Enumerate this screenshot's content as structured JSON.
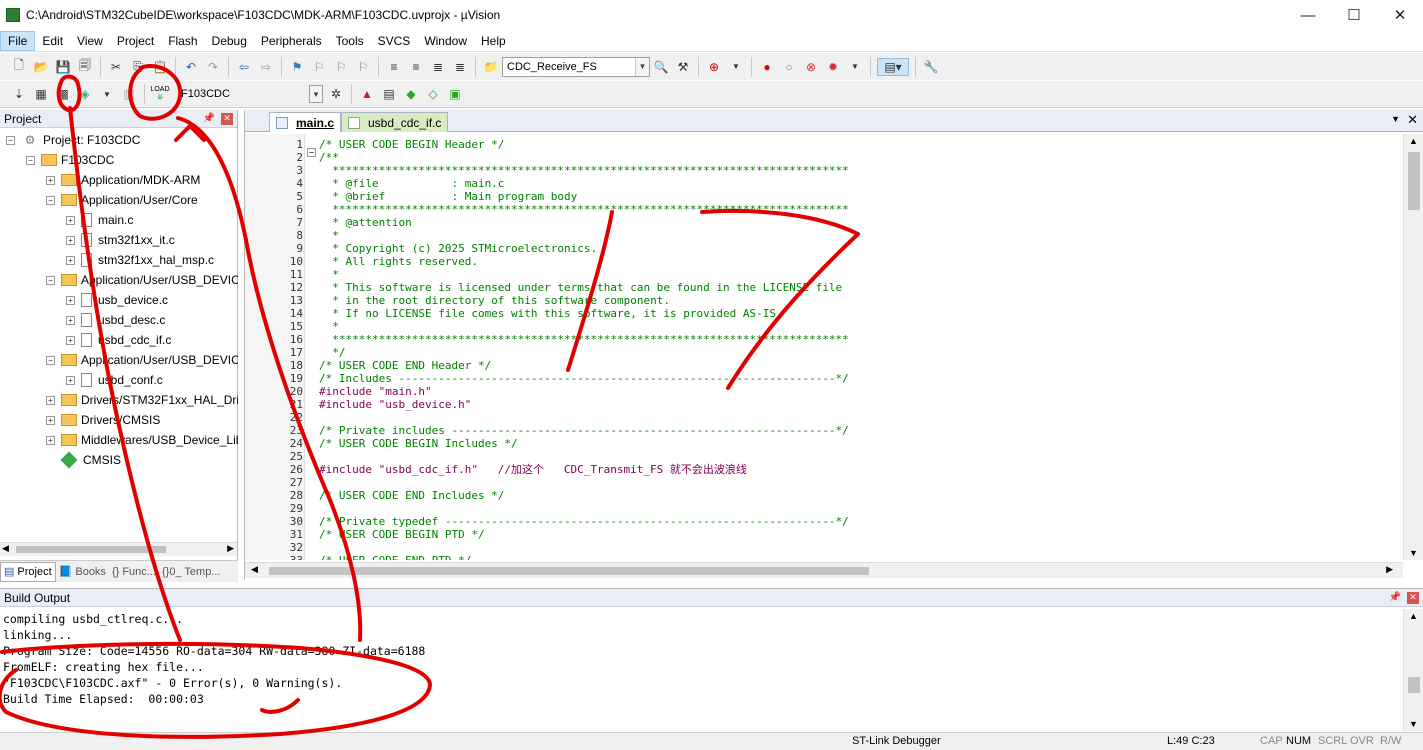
{
  "window": {
    "title": "C:\\Android\\STM32CubeIDE\\workspace\\F103CDC\\MDK-ARM\\F103CDC.uvprojx - µVision",
    "minimize": "—",
    "maximize": "☐",
    "close": "✕"
  },
  "menu": [
    "File",
    "Edit",
    "View",
    "Project",
    "Flash",
    "Debug",
    "Peripherals",
    "Tools",
    "SVCS",
    "Window",
    "Help"
  ],
  "toolbar1": {
    "function_combo": "CDC_Receive_FS"
  },
  "toolbar2": {
    "load_label": "LOAD",
    "target_combo": "F103CDC"
  },
  "project_panel": {
    "title": "Project",
    "tree": [
      {
        "label": "Project: F103CDC",
        "type": "root"
      },
      {
        "label": "F103CDC",
        "type": "target"
      },
      {
        "label": "Application/MDK-ARM",
        "type": "folder"
      },
      {
        "label": "Application/User/Core",
        "type": "folder"
      },
      {
        "label": "main.c",
        "type": "file"
      },
      {
        "label": "stm32f1xx_it.c",
        "type": "file"
      },
      {
        "label": "stm32f1xx_hal_msp.c",
        "type": "file"
      },
      {
        "label": "Application/User/USB_DEVIC",
        "type": "folder"
      },
      {
        "label": "usb_device.c",
        "type": "file"
      },
      {
        "label": "usbd_desc.c",
        "type": "file"
      },
      {
        "label": "usbd_cdc_if.c",
        "type": "file"
      },
      {
        "label": "Application/User/USB_DEVIC",
        "type": "folder"
      },
      {
        "label": "usbd_conf.c",
        "type": "file"
      },
      {
        "label": "Drivers/STM32F1xx_HAL_Driv",
        "type": "folder"
      },
      {
        "label": "Drivers/CMSIS",
        "type": "folder"
      },
      {
        "label": "Middlewares/USB_Device_Lib",
        "type": "folder"
      },
      {
        "label": "CMSIS",
        "type": "component"
      }
    ],
    "tabs": [
      "Project",
      "Books",
      "{} Func...",
      "{}0_ Temp..."
    ]
  },
  "editor": {
    "tabs": [
      "main.c",
      "usbd_cdc_if.c"
    ],
    "lines": [
      {
        "n": "1",
        "t": "/* USER CODE BEGIN Header */",
        "k": "cmt"
      },
      {
        "n": "2",
        "t": "/**",
        "k": "cmt"
      },
      {
        "n": "3",
        "t": "  ******************************************************************************",
        "k": "cmt"
      },
      {
        "n": "4",
        "t": "  * @file           : main.c",
        "k": "cmt"
      },
      {
        "n": "5",
        "t": "  * @brief          : Main program body",
        "k": "cmt"
      },
      {
        "n": "6",
        "t": "  ******************************************************************************",
        "k": "cmt"
      },
      {
        "n": "7",
        "t": "  * @attention",
        "k": "cmt"
      },
      {
        "n": "8",
        "t": "  *",
        "k": "cmt"
      },
      {
        "n": "9",
        "t": "  * Copyright (c) 2025 STMicroelectronics.",
        "k": "cmt"
      },
      {
        "n": "10",
        "t": "  * All rights reserved.",
        "k": "cmt"
      },
      {
        "n": "11",
        "t": "  *",
        "k": "cmt"
      },
      {
        "n": "12",
        "t": "  * This software is licensed under terms that can be found in the LICENSE file",
        "k": "cmt"
      },
      {
        "n": "13",
        "t": "  * in the root directory of this software component.",
        "k": "cmt"
      },
      {
        "n": "14",
        "t": "  * If no LICENSE file comes with this software, it is provided AS-IS.",
        "k": "cmt"
      },
      {
        "n": "15",
        "t": "  *",
        "k": "cmt"
      },
      {
        "n": "16",
        "t": "  ******************************************************************************",
        "k": "cmt"
      },
      {
        "n": "17",
        "t": "  */",
        "k": "cmt"
      },
      {
        "n": "18",
        "t": "/* USER CODE END Header */",
        "k": "cmt"
      },
      {
        "n": "19",
        "t": "/* Includes ------------------------------------------------------------------*/",
        "k": "cmt"
      },
      {
        "n": "20",
        "t": "#include \"main.h\"",
        "k": "pp"
      },
      {
        "n": "21",
        "t": "#include \"usb_device.h\"",
        "k": "pp"
      },
      {
        "n": "22",
        "t": "",
        "k": ""
      },
      {
        "n": "23",
        "t": "/* Private includes ----------------------------------------------------------*/",
        "k": "cmt"
      },
      {
        "n": "24",
        "t": "/* USER CODE BEGIN Includes */",
        "k": "cmt"
      },
      {
        "n": "25",
        "t": "",
        "k": ""
      },
      {
        "n": "26",
        "t": "#include \"usbd_cdc_if.h\"   //加这个   CDC_Transmit_FS 就不会出波浪线",
        "k": "pp"
      },
      {
        "n": "27",
        "t": "",
        "k": ""
      },
      {
        "n": "28",
        "t": "/* USER CODE END Includes */",
        "k": "cmt"
      },
      {
        "n": "29",
        "t": "",
        "k": ""
      },
      {
        "n": "30",
        "t": "/* Private typedef -----------------------------------------------------------*/",
        "k": "cmt"
      },
      {
        "n": "31",
        "t": "/* USER CODE BEGIN PTD */",
        "k": "cmt"
      },
      {
        "n": "32",
        "t": "",
        "k": ""
      },
      {
        "n": "33",
        "t": "/* USER CODE END PTD */",
        "k": "cmt"
      }
    ]
  },
  "build_output": {
    "title": "Build Output",
    "lines": [
      "compiling usbd_ctlreq.c...",
      "linking...",
      "Program Size: Code=14556 RO-data=304 RW-data=380 ZI-data=6188",
      "FromELF: creating hex file...",
      "\"F103CDC\\F103CDC.axf\" - 0 Error(s), 0 Warning(s).",
      "Build Time Elapsed:  00:00:03"
    ]
  },
  "statusbar": {
    "debugger": "ST-Link Debugger",
    "position": "L:49 C:23",
    "caps": "CAP",
    "num": "NUM",
    "scrl": "SCRL",
    "ovr": "OVR",
    "rw": "R/W"
  },
  "colors": {
    "annotation": "#e00000",
    "comment": "#008000",
    "preprocessor": "#7f0055",
    "menu_active": "#cce4f7"
  }
}
